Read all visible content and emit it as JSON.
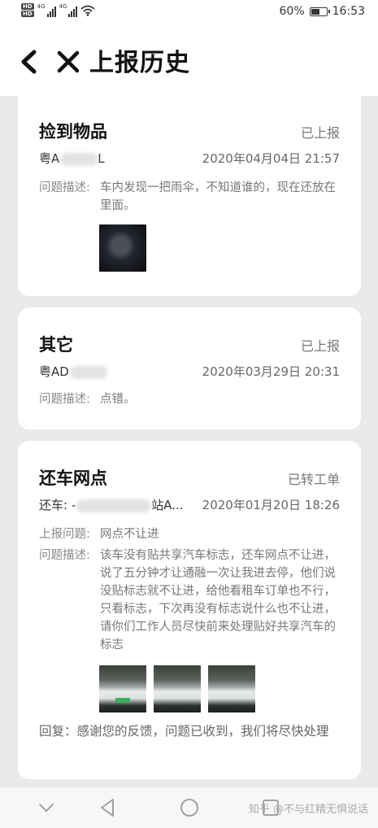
{
  "status_bar": {
    "hd_labels": [
      "HD",
      "HD"
    ],
    "network": [
      "4G",
      "4G"
    ],
    "battery_text": "60%",
    "battery_level": 0.6,
    "time": "16:53"
  },
  "header": {
    "title": "上报历史",
    "back_icon": "chevron-left-icon",
    "close_icon": "close-icon"
  },
  "reports": [
    {
      "title": "捡到物品",
      "status": "已上报",
      "plate": "粤A",
      "plate_suffix": "L",
      "time": "2020年04月04日 21:57",
      "desc_label": "问题描述:",
      "desc": "车内发现一把雨伞，不知道谁的，现在还放在里面。"
    },
    {
      "title": "其它",
      "status": "已上报",
      "plate": "粤AD",
      "time": "2020年03月29日 20:31",
      "desc_label": "问题描述:",
      "desc": "点错。"
    },
    {
      "title": "还车网点",
      "status": "已转工单",
      "station_label": "还车:",
      "station_prefix": "-",
      "station_suffix": "站A...",
      "time": "2020年01月20日 18:26",
      "issue_label": "上报问题:",
      "issue": "网点不让进",
      "desc_label": "问题描述:",
      "desc": "该车没有贴共享汽车标志，还车网点不让进，说了五分钟才让通融一次让我进去停，他们说没贴标志就不让进，给他看租车订单也不行，只看标志，下次再没有标志说什么也不让进，请你们工作人员尽快前来处理贴好共享汽车的标志",
      "reply": "回复：感谢您的反馈，问题已收到，我们将尽快处理"
    }
  ],
  "nav_bar": {
    "buttons": [
      "chevron-down-icon",
      "back-triangle-icon",
      "home-circle-icon",
      "recents-square-icon"
    ],
    "watermark": "知乎 @不与红精无惧说话"
  },
  "colors": {
    "background": "#e9ebea",
    "card": "#ffffff",
    "title": "#111111",
    "secondary": "#777777"
  }
}
